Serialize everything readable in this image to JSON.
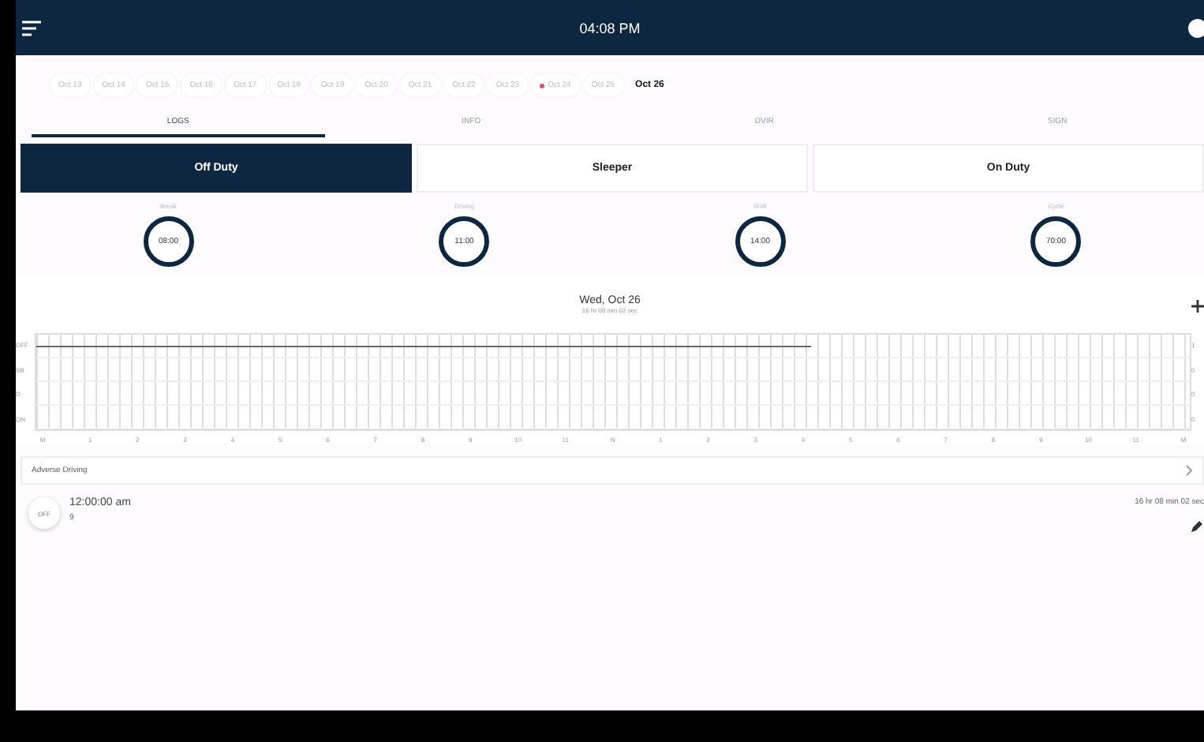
{
  "top_bar": {
    "time": "04:08 PM"
  },
  "dates": [
    {
      "label": "Oct 13",
      "selected": false,
      "flag": false
    },
    {
      "label": "Oct 14",
      "selected": false,
      "flag": false
    },
    {
      "label": "Oct 15",
      "selected": false,
      "flag": false
    },
    {
      "label": "Oct 16",
      "selected": false,
      "flag": false
    },
    {
      "label": "Oct 17",
      "selected": false,
      "flag": false
    },
    {
      "label": "Oct 18",
      "selected": false,
      "flag": false
    },
    {
      "label": "Oct 19",
      "selected": false,
      "flag": false
    },
    {
      "label": "Oct 20",
      "selected": false,
      "flag": false
    },
    {
      "label": "Oct 21",
      "selected": false,
      "flag": false
    },
    {
      "label": "Oct 22",
      "selected": false,
      "flag": false
    },
    {
      "label": "Oct 23",
      "selected": false,
      "flag": false
    },
    {
      "label": "Oct 24",
      "selected": false,
      "flag": true
    },
    {
      "label": "Oct 25",
      "selected": false,
      "flag": false
    },
    {
      "label": "Oct 26",
      "selected": true,
      "flag": false
    }
  ],
  "tabs": [
    {
      "label": "LOGS",
      "selected": true
    },
    {
      "label": "INFO",
      "selected": false
    },
    {
      "label": "DVIR",
      "selected": false
    },
    {
      "label": "SIGN",
      "selected": false
    }
  ],
  "statuses": [
    {
      "label": "Off Duty",
      "selected": true
    },
    {
      "label": "Sleeper",
      "selected": false
    },
    {
      "label": "On Duty",
      "selected": false
    }
  ],
  "clocks": [
    {
      "label": "Break",
      "value": "08:00"
    },
    {
      "label": "Driving",
      "value": "11:00"
    },
    {
      "label": "Shift",
      "value": "14:00"
    },
    {
      "label": "Cycle",
      "value": "70:00"
    }
  ],
  "day": {
    "title": "Wed, Oct 26",
    "subtitle": "16 hr 08 min 02 sec"
  },
  "grid": {
    "rows": [
      {
        "label": "OFF",
        "level": 0.672,
        "total": "1"
      },
      {
        "label": "SB",
        "total": "0"
      },
      {
        "label": "D",
        "total": "0"
      },
      {
        "label": "ON",
        "total": "0"
      }
    ],
    "hours": [
      "M",
      "1",
      "2",
      "3",
      "4",
      "5",
      "6",
      "7",
      "8",
      "9",
      "10",
      "11",
      "N",
      "1",
      "2",
      "3",
      "4",
      "5",
      "6",
      "7",
      "8",
      "9",
      "10",
      "11",
      "M"
    ]
  },
  "adverse": {
    "label": "Adverse Driving"
  },
  "events": [
    {
      "status": "OFF",
      "time": "12:00:00 am",
      "location": "9",
      "duration": "16 hr 08 min 02 sec"
    }
  ]
}
